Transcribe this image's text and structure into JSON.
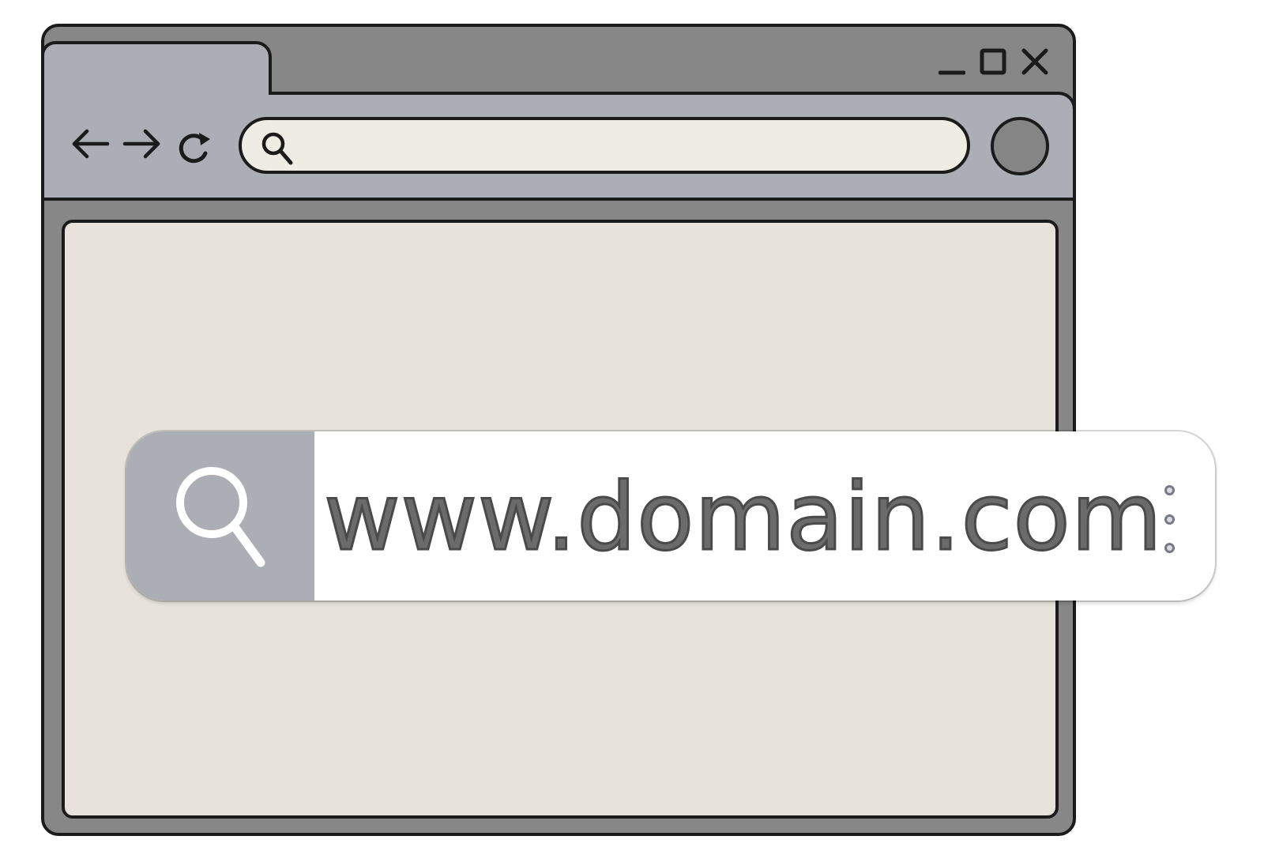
{
  "browser": {
    "window_controls": [
      "minimize-icon",
      "maximize-icon",
      "close-icon"
    ],
    "nav": [
      "back-arrow-icon",
      "forward-arrow-icon",
      "reload-icon"
    ],
    "address_bar": {
      "icon": "search-icon",
      "value": ""
    },
    "profile_button": "circle",
    "content": ""
  },
  "search_bar": {
    "icon": "search-icon",
    "url": "www.domain.com",
    "menu_icon": "vertical-dots-icon"
  },
  "colors": {
    "window_frame": "#878787",
    "toolbar": "#acaeb5",
    "address_bar_bg": "#efece3",
    "content_bg": "#e7e3dc",
    "outline": "#1b1b1b",
    "search_panel": "#acaeb5",
    "url_text": "#6b6b6b"
  }
}
